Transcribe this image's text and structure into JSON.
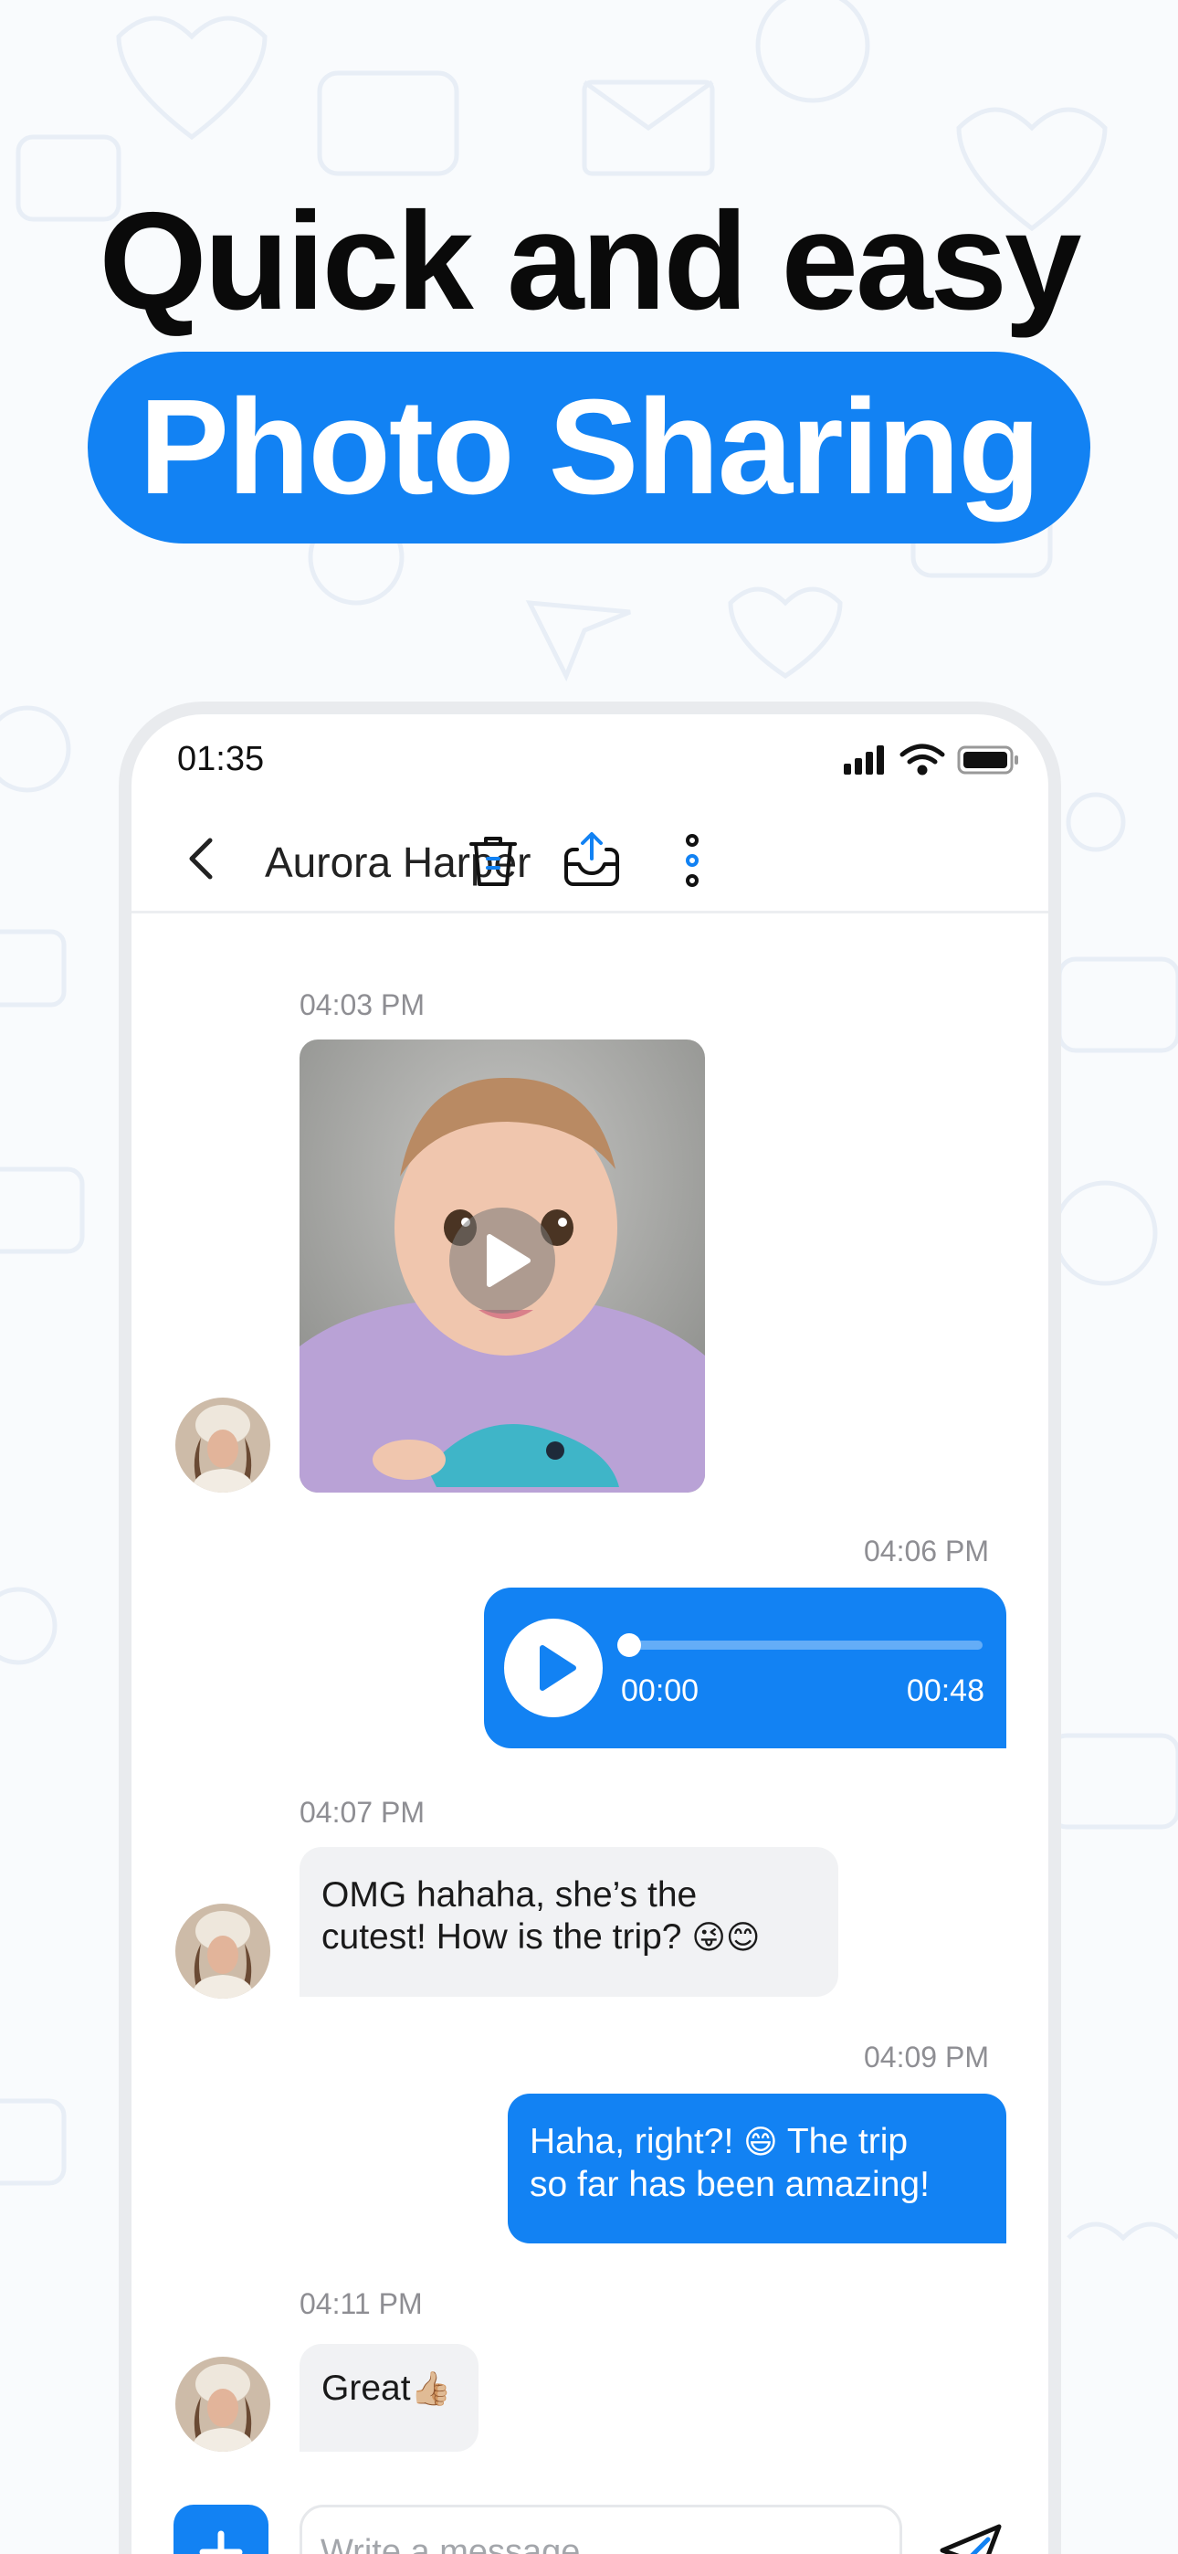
{
  "promo": {
    "headline": "Quick and easy",
    "highlight": "Photo Sharing"
  },
  "status_bar": {
    "time": "01:35",
    "icons": [
      "signal-icon",
      "wifi-icon",
      "battery-icon"
    ]
  },
  "header": {
    "contact_name": "Aurora Harper",
    "actions": [
      "back-icon",
      "trash-icon",
      "share-inbox-icon",
      "more-vertical-icon"
    ]
  },
  "messages": [
    {
      "direction": "incoming",
      "time": "04:03 PM",
      "type": "video"
    },
    {
      "direction": "outgoing",
      "time": "04:06 PM",
      "type": "voice",
      "elapsed": "00:00",
      "duration": "00:48",
      "progress": 0
    },
    {
      "direction": "incoming",
      "time": "04:07 PM",
      "type": "text",
      "line1": "OMG hahaha, she’s the",
      "line2": "cutest! How is the trip?",
      "emoji": "😜😊"
    },
    {
      "direction": "outgoing",
      "time": "04:09 PM",
      "type": "text",
      "line1": "Haha, right?!",
      "emoji": "😄",
      "line1b": "The trip",
      "line2": "so far has been amazing!"
    },
    {
      "direction": "incoming",
      "time": "04:11 PM",
      "type": "text",
      "text": "Great",
      "emoji": "👍🏼"
    }
  ],
  "composer": {
    "placeholder": "Write a message..."
  },
  "colors": {
    "accent": "#1282f3",
    "incoming_bubble": "#f1f2f4",
    "timestamp": "#8e8e93",
    "background": "#f9fbfd"
  }
}
